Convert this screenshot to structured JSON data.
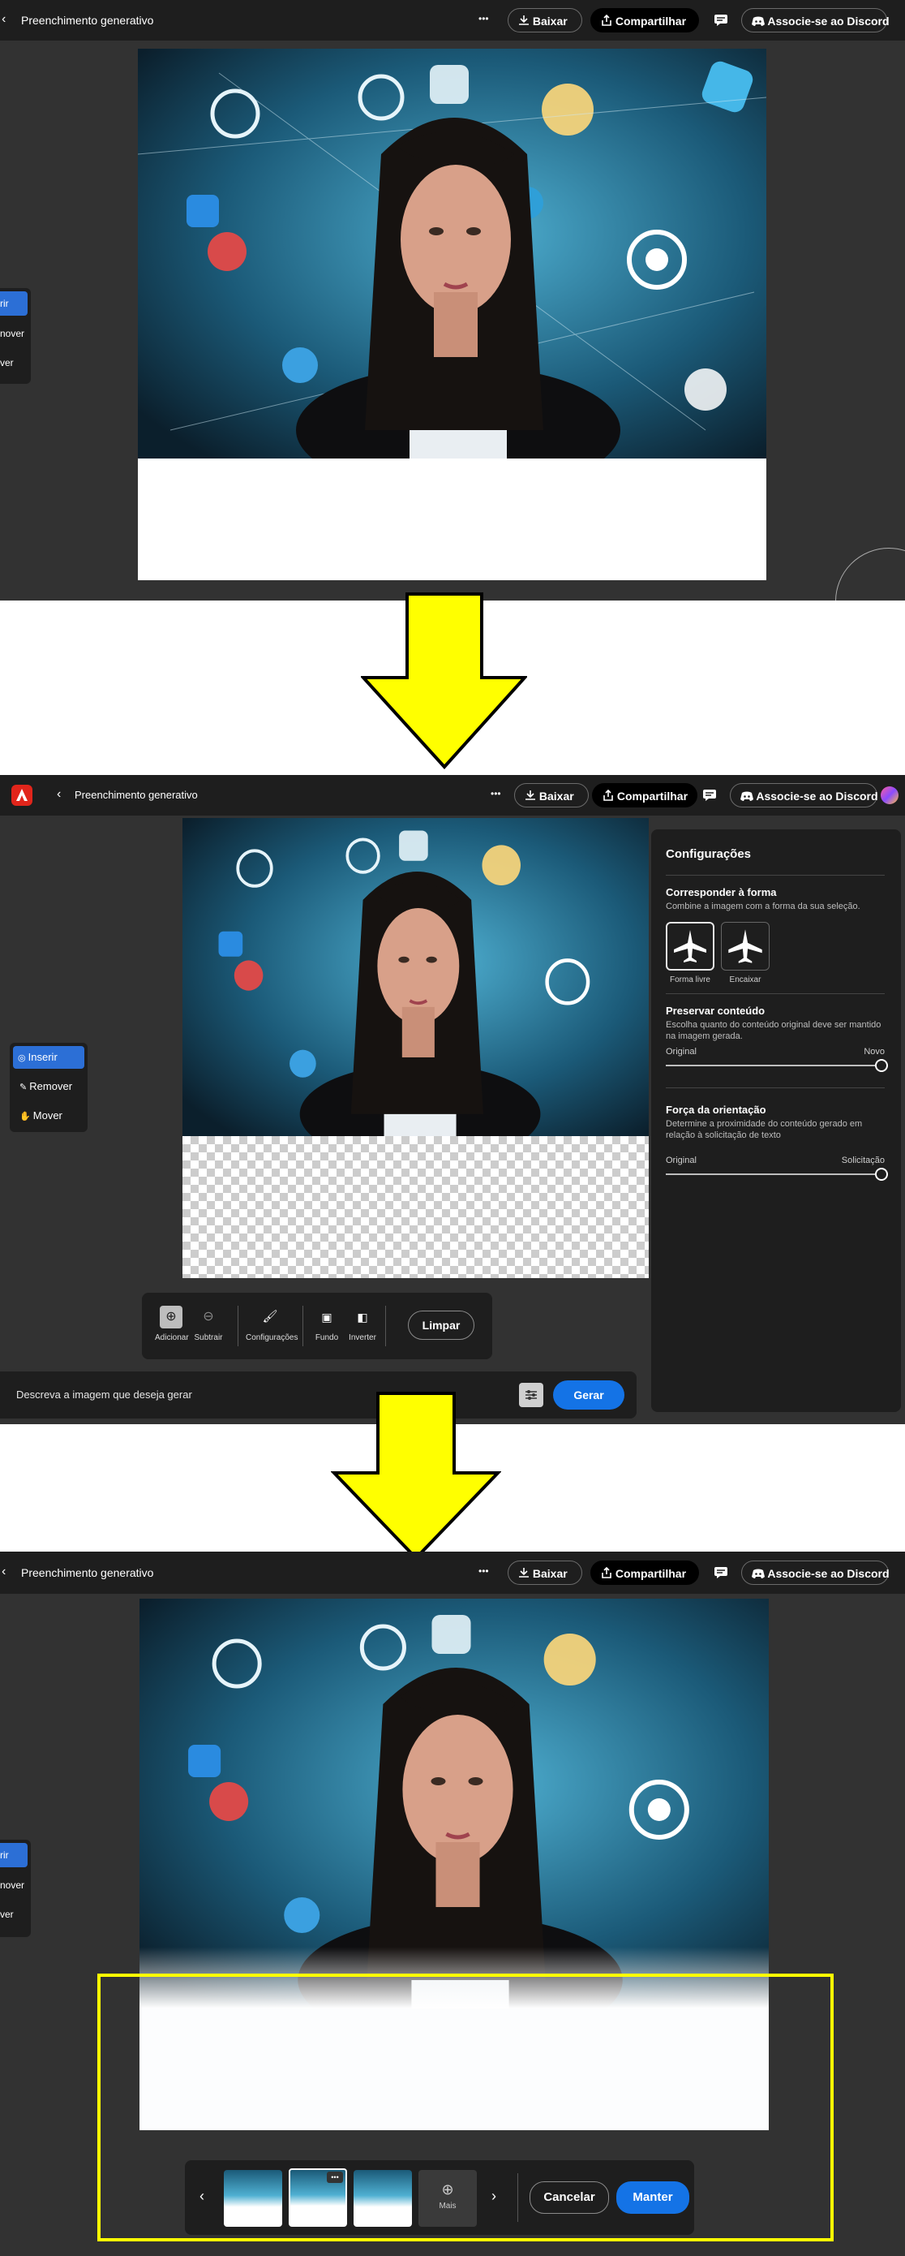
{
  "app": {
    "title": "Preenchimento generativo",
    "more_label": "•••",
    "download_label": "Baixar",
    "share_label": "Compartilhar",
    "discord_label": "Associe-se ao Discord"
  },
  "sidebar_partial": {
    "items": [
      "rir",
      "nover",
      "ver"
    ]
  },
  "sidebar_full": {
    "items": [
      "Inserir",
      "Remover",
      "Mover"
    ]
  },
  "settings": {
    "title": "Configurações",
    "match_shape": {
      "title": "Corresponder à forma",
      "desc": "Combine a imagem com a forma da sua seleção.",
      "options": [
        "Forma livre",
        "Encaixar"
      ]
    },
    "preserve": {
      "title": "Preservar conteúdo",
      "desc": "Escolha quanto do conteúdo original deve ser mantido na imagem gerada.",
      "min_label": "Original",
      "max_label": "Novo",
      "value": 1.0
    },
    "guidance": {
      "title": "Força da orientação",
      "desc": "Determine a proximidade do conteúdo gerado em relação à solicitação de texto",
      "min_label": "Original",
      "max_label": "Solicitação",
      "value": 1.0
    }
  },
  "toolbar": {
    "add": "Adicionar",
    "subtract": "Subtrair",
    "settings": "Configurações",
    "background": "Fundo",
    "invert": "Inverter",
    "clear": "Limpar"
  },
  "prompt": {
    "placeholder": "Descreva a imagem que deseja gerar",
    "generate": "Gerar"
  },
  "variations": {
    "more": "Mais",
    "cancel": "Cancelar",
    "keep": "Manter"
  },
  "colors": {
    "arrow": "#ffff00",
    "highlight": "#ffff00",
    "accent": "#1473e6",
    "adobe_red": "#e1251b"
  }
}
